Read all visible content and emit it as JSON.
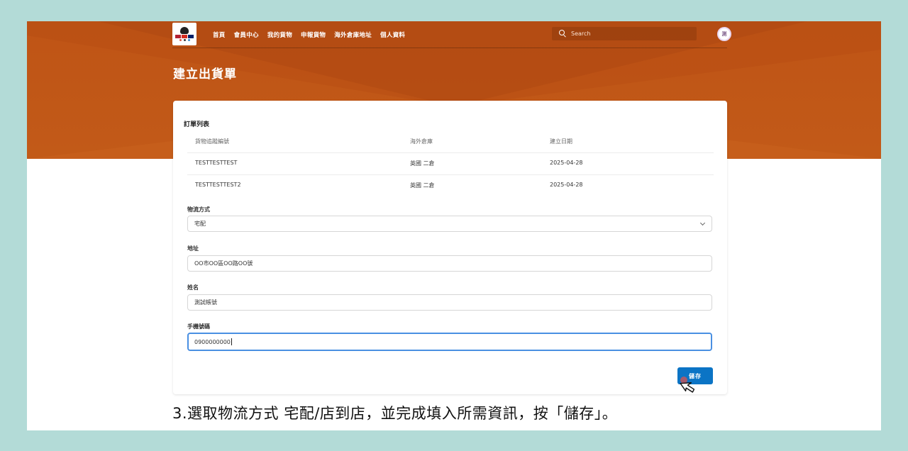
{
  "nav": {
    "links": [
      "首頁",
      "會員中心",
      "我的貨物",
      "申報貨物",
      "海外倉庫地址",
      "個人資料"
    ],
    "search_placeholder": "Search",
    "avatar_text": "測"
  },
  "page": {
    "title": "建立出貨單"
  },
  "orders": {
    "title": "訂單列表",
    "headers": [
      "貨物追蹤編號",
      "海外倉庫",
      "建立日期"
    ],
    "rows": [
      [
        "TESTTESTTEST",
        "英國 二倉",
        "2025-04-28"
      ],
      [
        "TESTTESTTEST2",
        "英國 二倉",
        "2025-04-28"
      ]
    ]
  },
  "form": {
    "shipping_label": "物流方式",
    "shipping_value": "宅配",
    "address_label": "地址",
    "address_value": "OO市OO區OO路OO號",
    "name_label": "姓名",
    "name_value": "測試帳號",
    "phone_label": "手機號碼",
    "phone_value": "0900000000",
    "save_label": "儲存"
  },
  "caption": "3.選取物流方式 宅配/店到店，並完成填入所需資訊，按「儲存」。",
  "colors": {
    "header": "#bf5416",
    "primary": "#0b74c5",
    "background": "#b3dbd7"
  }
}
